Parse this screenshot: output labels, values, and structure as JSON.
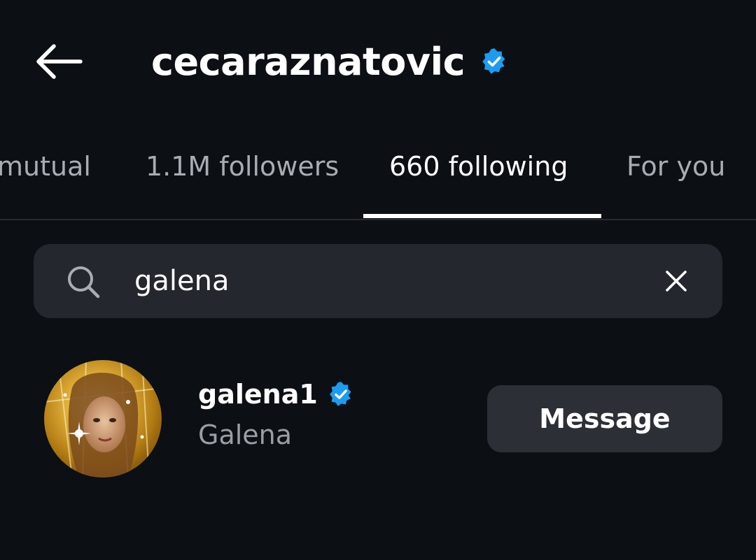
{
  "header": {
    "title": "cecaraznatovic",
    "back_icon": "back-arrow-icon",
    "verified_icon": "verified-badge-icon",
    "verified_color": "#1d9bf0"
  },
  "tabs": [
    {
      "label": "mutual",
      "active": false
    },
    {
      "label": "1.1M followers",
      "active": false
    },
    {
      "label": "660 following",
      "active": true
    },
    {
      "label": "For you",
      "active": false
    }
  ],
  "search": {
    "value": "galena",
    "icon": "search-icon",
    "clear_icon": "close-icon"
  },
  "results": [
    {
      "username": "galena1",
      "full_name": "Galena",
      "verified": true,
      "button_label": "Message"
    }
  ],
  "colors": {
    "background": "#0c0f14",
    "search_bg": "#24272d",
    "button_bg": "#2c2f35",
    "muted_text": "#9a9ea5",
    "accent": "#1d9bf0"
  }
}
